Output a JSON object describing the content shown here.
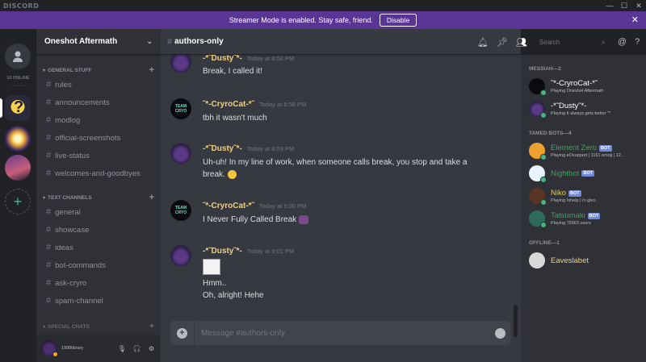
{
  "titlebar": {
    "brand": "DISCORD",
    "minimize": "—",
    "maximize": "☐",
    "close": "✕"
  },
  "banner": {
    "message": "Streamer Mode is enabled. Stay safe, friend.",
    "disable_label": "Disable",
    "close": "✕"
  },
  "guilds": {
    "online_count": "10 ONLINE",
    "add": "+"
  },
  "server": {
    "name": "Oneshot Aftermath",
    "chevron": "⌄"
  },
  "categories": [
    {
      "name": "GENERAL STUFF",
      "channels": [
        "rules",
        "announcements",
        "modlog",
        "official-screenshots",
        "live-status",
        "welcomes-and-goodbyes"
      ]
    },
    {
      "name": "TEXT CHANNELS",
      "channels": [
        "general",
        "showcase",
        "ideas",
        "bot-commands",
        "ask-cryro",
        "spam-channel"
      ]
    },
    {
      "name": "SPECIAL CHATS"
    }
  ],
  "user_panel": {
    "username": "1998library"
  },
  "channel": {
    "name": "authors-only"
  },
  "search": {
    "placeholder": "Search"
  },
  "messages": [
    {
      "author": "-*˜Dusty˜*-",
      "timestamp": "Today at 8:58 PM",
      "lines": [
        "Break, I called it!"
      ]
    },
    {
      "author": "˜*-CryroCat-*˜",
      "timestamp": "Today at 8:58 PM",
      "lines": [
        "tbh it wasn't much"
      ]
    },
    {
      "author": "-*˜Dusty˜*-",
      "timestamp": "Today at 8:59 PM",
      "lines": [
        "Uh-uh! In my line of work, when someone calls break, you stop and take a break."
      ]
    },
    {
      "author": "˜*-CryroCat-*˜",
      "timestamp": "Today at 9:00 PM",
      "lines": [
        "I Never Fully Called Break"
      ]
    },
    {
      "author": "-*˜Dusty˜*-",
      "timestamp": "Today at 9:01 PM",
      "lines": [
        "Hmm..",
        "Oh, alright! Hehe"
      ]
    }
  ],
  "composer": {
    "placeholder": "Message #authors-only"
  },
  "members": {
    "roles": [
      {
        "name": "MESSIAH—2",
        "members": [
          {
            "name": "˜*-CryroCat-*˜",
            "activity": "Playing Oneshot Aftermath",
            "color": "#ffffff",
            "status": "online",
            "bot": false
          },
          {
            "name": "-*˜Dusty˜*-",
            "activity": "Playing It always gets better ˜*",
            "color": "#ffffff",
            "status": "online",
            "bot": false
          }
        ]
      },
      {
        "name": "TAMED BOTS—4",
        "members": [
          {
            "name": "Element Zero",
            "activity": "Playing eOsupport | 1161 emoji | 12..",
            "color": "#3ba55c",
            "status": "online",
            "bot": true,
            "bot_label": "BOT"
          },
          {
            "name": "Nightbot",
            "activity": "",
            "color": "#3ba55c",
            "status": "online",
            "bot": true,
            "bot_label": "BOT"
          },
          {
            "name": "Niko",
            "activity": "Playing !nhelp | In glen",
            "color": "#f0cf30",
            "status": "online",
            "bot": true,
            "bot_label": "BOT"
          },
          {
            "name": "Tatsumaki",
            "activity": "Playing 79363 users",
            "color": "#3ba55c",
            "status": "online",
            "bot": true,
            "bot_label": "BOT"
          }
        ]
      },
      {
        "name": "OFFLINE—1",
        "members": [
          {
            "name": "Eaveslabet",
            "activity": "",
            "color": "#f0cf7a",
            "status": "offline",
            "bot": false
          }
        ]
      }
    ]
  },
  "colors": {
    "banner": "#593695",
    "online": "#43b581",
    "idle": "#faa61a",
    "accent": "#7289da"
  }
}
